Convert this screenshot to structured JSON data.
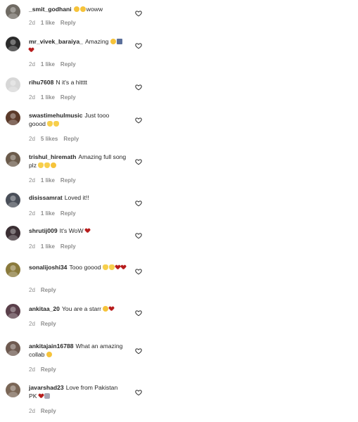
{
  "comments": [
    {
      "user": "_smit_godhani",
      "text": "woww",
      "emoji": [
        "face",
        "face"
      ],
      "emoji_pos": "before",
      "time": "2d",
      "likes": "1 like",
      "reply": "Reply",
      "avatar_color": "#6f6a63"
    },
    {
      "user": "mr_vivek_baraiya_",
      "text": "Amazing",
      "emoji": [
        "face",
        "photo",
        "red"
      ],
      "emoji_pos": "after",
      "time": "2d",
      "likes": "1 like",
      "reply": "Reply",
      "avatar_color": "#2b2b2b"
    },
    {
      "user": "rihu7608",
      "text": "N it's a hitttt",
      "emoji": [],
      "emoji_pos": "after",
      "time": "2d",
      "likes": "1 like",
      "reply": "Reply",
      "avatar_color": "#d7d7d7"
    },
    {
      "user": "swastimehulmusic",
      "text": "Just tooo goood",
      "emoji": [
        "hand",
        "hand"
      ],
      "emoji_pos": "after",
      "time": "2d",
      "likes": "5 likes",
      "reply": "Reply",
      "avatar_color": "#5b3a2a"
    },
    {
      "user": "trishul_hiremath",
      "text": "Amazing full song plz",
      "emoji": [
        "hand",
        "hand",
        "face"
      ],
      "emoji_pos": "split",
      "time": "2d",
      "likes": "1 like",
      "reply": "Reply",
      "avatar_color": "#6b5b4b"
    },
    {
      "user": "disissamrat",
      "text": "Loved it!!",
      "emoji": [],
      "emoji_pos": "after",
      "time": "2d",
      "likes": "1 like",
      "reply": "Reply",
      "avatar_color": "#4a4f59"
    },
    {
      "user": "shrutij009",
      "text": "It's WoW",
      "emoji": [
        "red"
      ],
      "emoji_pos": "after",
      "time": "2d",
      "likes": "1 like",
      "reply": "Reply",
      "avatar_color": "#3a2e33"
    },
    {
      "user": "sonalijoshi34",
      "text": "Tooo goood",
      "emoji": [
        "hand",
        "hand",
        "red",
        "red"
      ],
      "emoji_pos": "after",
      "time": "2d",
      "likes": "",
      "reply": "Reply",
      "avatar_color": "#8a7a3c"
    },
    {
      "user": "ankitaa_20",
      "text": "You are a starr",
      "emoji": [
        "face",
        "red"
      ],
      "emoji_pos": "after",
      "time": "2d",
      "likes": "",
      "reply": "Reply",
      "avatar_color": "#5a3f4a"
    },
    {
      "user": "ankitajain16788",
      "text": "What an amazing collab",
      "emoji": [
        "face"
      ],
      "emoji_pos": "after",
      "time": "2d",
      "likes": "",
      "reply": "Reply",
      "avatar_color": "#6e5a50"
    },
    {
      "user": "javarshad23",
      "text": "Love from Pakistan PK",
      "emoji": [
        "red",
        "grey"
      ],
      "emoji_pos": "after",
      "time": "2d",
      "likes": "",
      "reply": "Reply",
      "avatar_color": "#7a6656"
    }
  ],
  "colors": {
    "text": "#262626",
    "meta": "#8e8e8e",
    "heart_outline": "#262626"
  }
}
